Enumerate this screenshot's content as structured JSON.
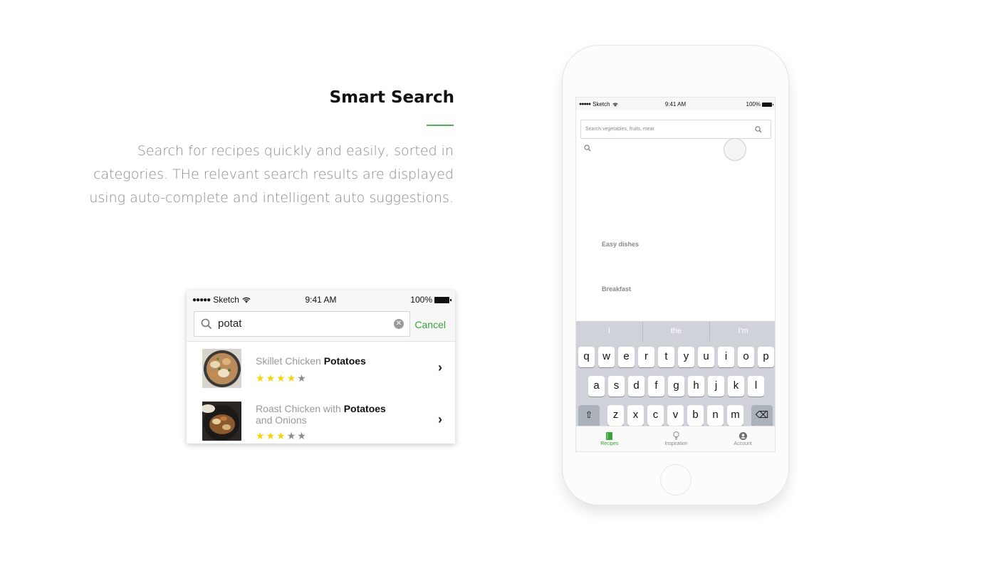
{
  "section": {
    "heading": "Smart Search",
    "accent_color": "#4caf50",
    "description_lines": [
      "Search for recipes quickly and easily, sorted in",
      "categories. THe relevant search results are displayed",
      "using auto-complete and intelligent auto suggestions."
    ]
  },
  "result_card": {
    "status": {
      "carrier": "Sketch",
      "time": "9:41 AM",
      "battery": "100%"
    },
    "search": {
      "query": "potat",
      "cancel_label": "Cancel"
    },
    "results": [
      {
        "title_plain": "Skillet Chicken ",
        "title_bold": "Potatoes",
        "title_tail": "",
        "rating": 4,
        "max_rating": 5
      },
      {
        "title_plain": "Roast Chicken with ",
        "title_bold": "Potatoes",
        "title_tail": "and Onions",
        "rating": 3,
        "max_rating": 5
      }
    ],
    "star_on_color": "#f5d210",
    "star_off_color": "#8c8c8c"
  },
  "phone": {
    "status": {
      "carrier": "Sketch",
      "time": "9:41 AM",
      "battery": "100%"
    },
    "search_placeholder": "Search vegetables, fruits, meat",
    "categories": [
      "Easy dishes",
      "Breakfast"
    ],
    "keyboard": {
      "suggestions": [
        "I",
        "the",
        "I'm"
      ],
      "row1": [
        "q",
        "w",
        "e",
        "r",
        "t",
        "y",
        "u",
        "i",
        "o",
        "p"
      ],
      "row2": [
        "a",
        "s",
        "d",
        "f",
        "g",
        "h",
        "j",
        "k",
        "l"
      ],
      "row3": [
        "z",
        "x",
        "c",
        "v",
        "b",
        "n",
        "m"
      ]
    },
    "tabs": [
      {
        "label": "Recipes",
        "icon": "book-icon",
        "active": true
      },
      {
        "label": "Inspiration",
        "icon": "lightbulb-icon",
        "active": false
      },
      {
        "label": "Account",
        "icon": "account-icon",
        "active": false
      }
    ],
    "active_color": "#3aa33a"
  }
}
